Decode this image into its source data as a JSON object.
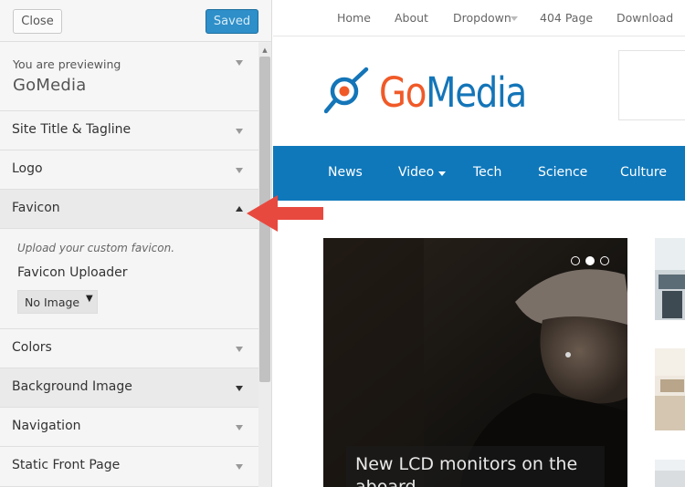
{
  "sidebar": {
    "close_label": "Close",
    "saved_label": "Saved",
    "previewing_label": "You are previewing",
    "theme_name": "GoMedia",
    "sections": [
      {
        "label": "Site Title & Tagline"
      },
      {
        "label": "Logo"
      },
      {
        "label": "Favicon"
      },
      {
        "label": "Colors"
      },
      {
        "label": "Background Image"
      },
      {
        "label": "Navigation"
      },
      {
        "label": "Static Front Page"
      }
    ],
    "favicon": {
      "description": "Upload your custom favicon.",
      "uploader_label": "Favicon Uploader",
      "select_value": "No Image"
    }
  },
  "site": {
    "top_nav": [
      "Home",
      "About",
      "Dropdown",
      "404 Page",
      "Download"
    ],
    "logo": {
      "part1": "Go",
      "part2": "Media"
    },
    "main_nav": [
      "News",
      "Video",
      "Tech",
      "Science",
      "Culture"
    ],
    "slider": {
      "caption": "New LCD monitors on the aboard",
      "dots": 3,
      "active_dot": 1
    }
  },
  "colors": {
    "accent_blue": "#0f78bb",
    "logo_orange": "#f05a28",
    "saved_button": "#2e8fc9",
    "annotation_red": "#e8493f"
  },
  "icons": {
    "section_toggle": "chevron-down-icon",
    "favicon_open": "chevron-up-icon",
    "logo": "target-magnifier-icon",
    "annotation": "red-arrow-icon"
  }
}
